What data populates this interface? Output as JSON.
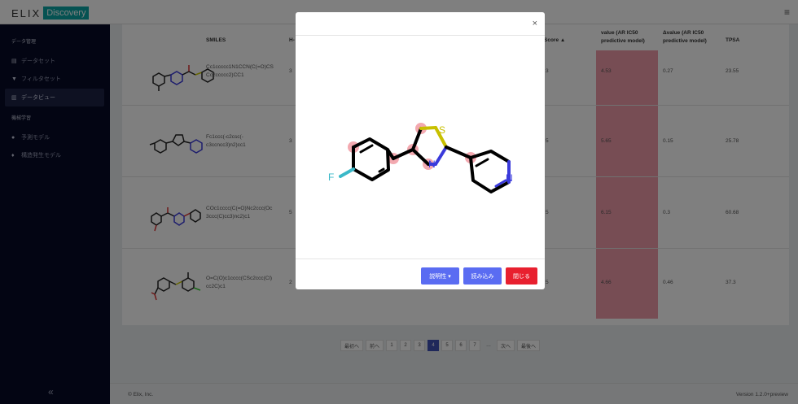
{
  "app": {
    "logo_text": "ELIX",
    "logo_badge": "Discovery",
    "menu_icon": "hamburger-icon"
  },
  "sidebar": {
    "section1": "データ管理",
    "items1": [
      {
        "label": "データセット",
        "icon": "database-icon"
      },
      {
        "label": "フィルタセット",
        "icon": "filter-icon"
      },
      {
        "label": "データビュー",
        "icon": "chart-icon"
      }
    ],
    "section2": "機械学習",
    "items2": [
      {
        "label": "予測モデル",
        "icon": "search-icon"
      },
      {
        "label": "構造発生モデル",
        "icon": "bulb-icon"
      }
    ],
    "collapse": "«"
  },
  "table": {
    "headers": {
      "smiles": "SMILES",
      "h": "H-",
      "score": "Score ▲",
      "value": "value (AR IC50 predictive model)",
      "dvalue": "Δvalue (AR IC50 predictive model)",
      "tpsa": "TPSA"
    },
    "rows": [
      {
        "smiles": "Cc1ccccc1N1CCN(C(=O)CS Cc2ccccc2)CC1",
        "h": "3",
        "score": "3",
        "value": "4.53",
        "dvalue": "0.27",
        "tpsa": "23.55"
      },
      {
        "smiles": "Fc1ccc(-c2csc(- c3ccncc3)n2)cc1",
        "h": "3",
        "score": "5",
        "value": "5.65",
        "dvalue": "0.15",
        "tpsa": "25.78"
      },
      {
        "smiles": "COc1cccc(C(=O)Nc2ccc(Oc 3ccc(C)cc3)nc2)c1",
        "h": "5",
        "score": "5",
        "value": "6.15",
        "dvalue": "0.3",
        "tpsa": "60.68"
      },
      {
        "smiles": "O=C(O)c1cccc(CSc2ccc(Cl) cc2C)c1",
        "h": "2",
        "score": "5",
        "value": "4.66",
        "dvalue": "0.46",
        "tpsa": "37.3"
      }
    ]
  },
  "pagination": [
    "最初へ",
    "前へ",
    "1",
    "2",
    "3",
    "4",
    "5",
    "6",
    "7",
    "…",
    "次へ",
    "最後へ"
  ],
  "pagination_active": "4",
  "footer": {
    "left": "© Elix, Inc.",
    "right": "Version 1.2.0+preview"
  },
  "modal": {
    "close": "×",
    "atom_f": "F",
    "atom_s": "S",
    "atom_n1": "N",
    "atom_n2": "N",
    "btn_explain": "説明性 ▾",
    "btn_load": "読み込み",
    "btn_close": "閉じる"
  },
  "colors": {
    "accent": "#5a6cf2",
    "danger": "#e8202f",
    "highlight": "#ef9aa8",
    "sidebar": "#070b26",
    "logo": "#0aa5a5"
  }
}
